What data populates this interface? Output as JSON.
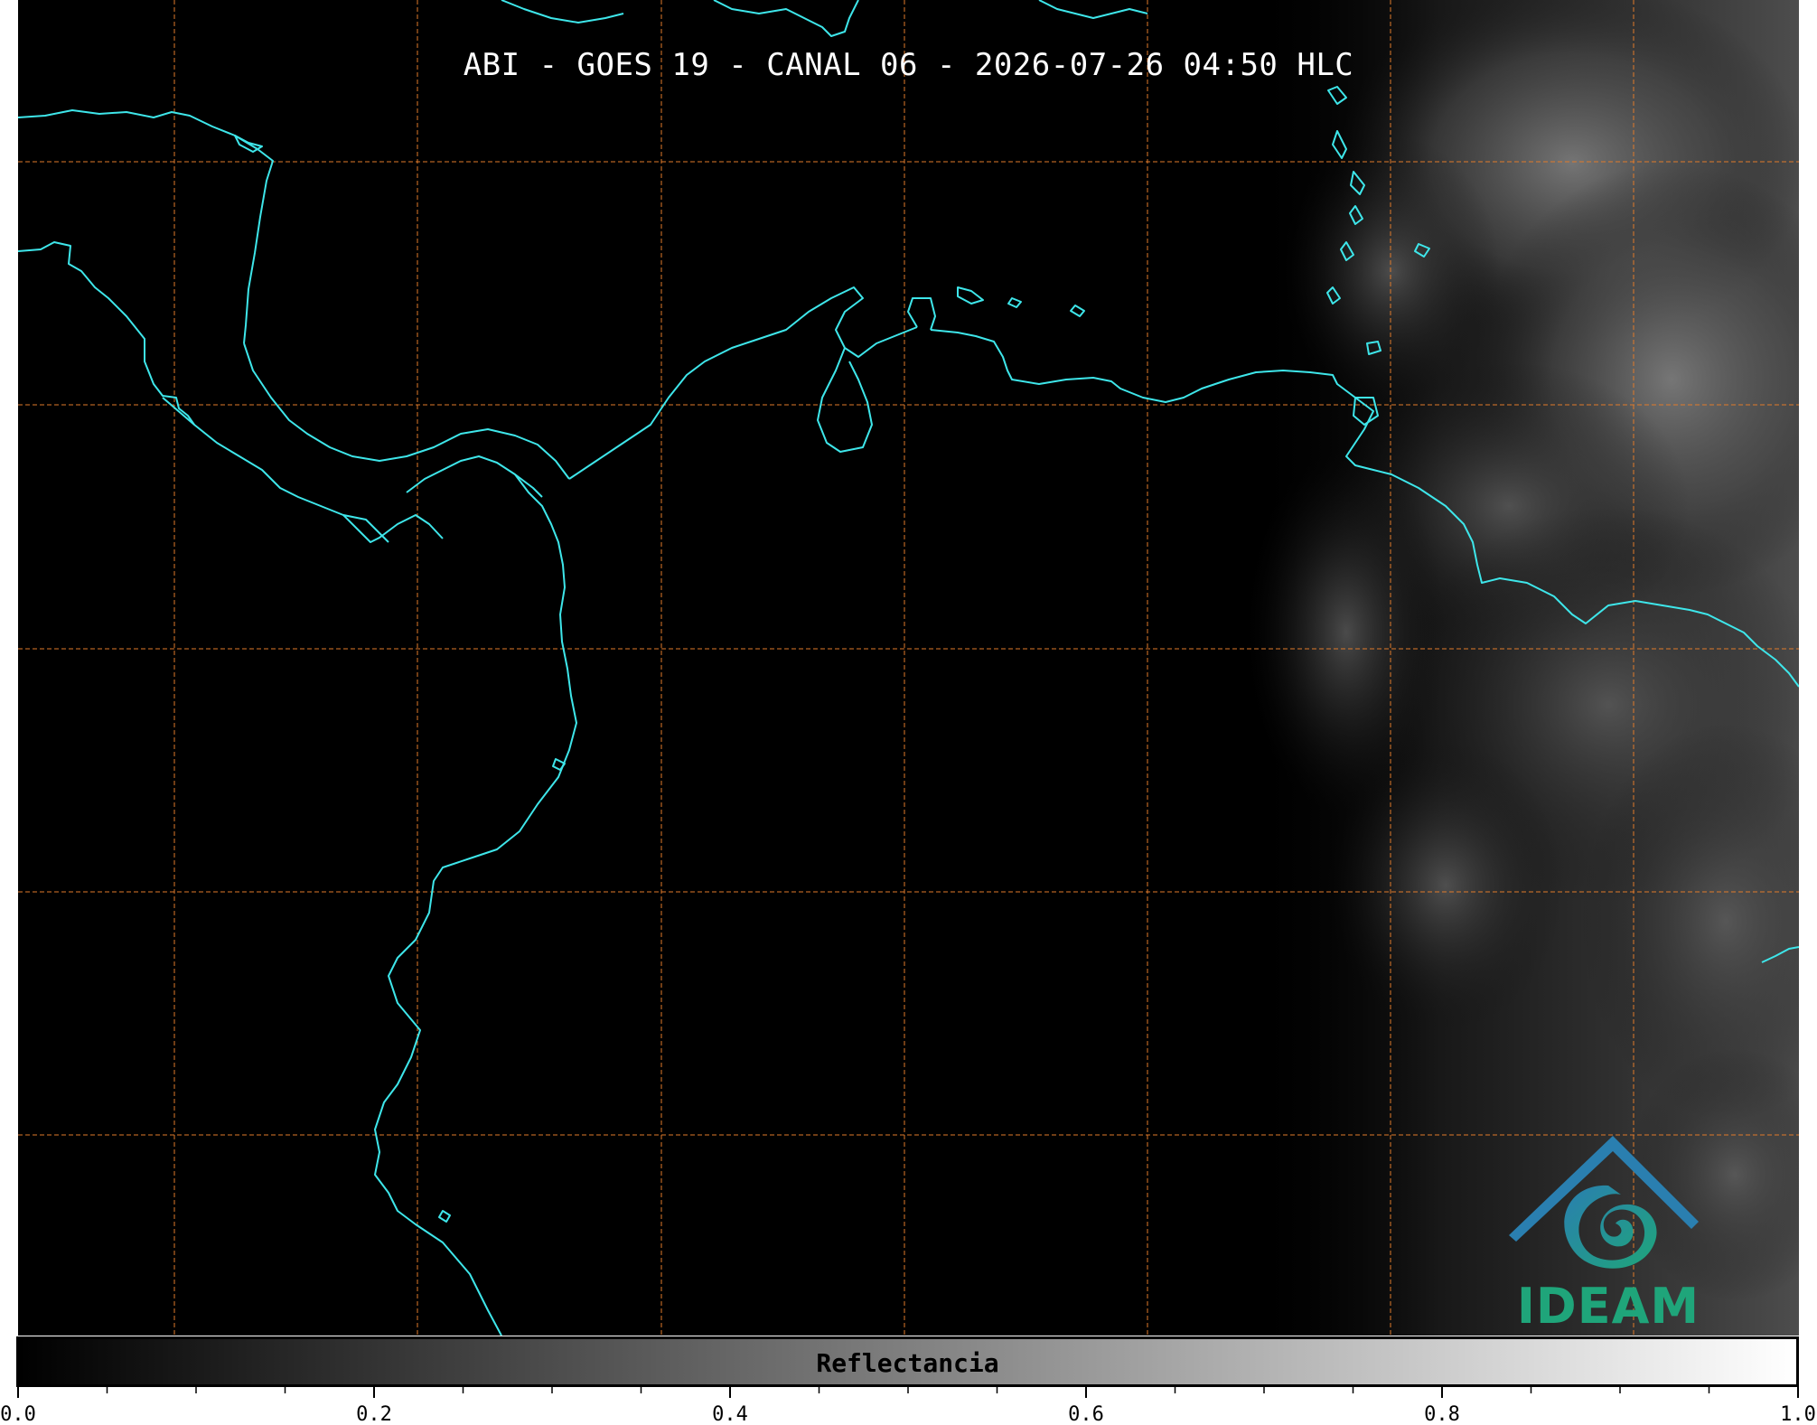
{
  "map": {
    "title": "ABI - GOES 19 - CANAL 06 - 2026-07-26 04:50 HLC",
    "gridline_color": "#e07a2a",
    "coastline_color": "#3ee6ea",
    "background_color": "#000000",
    "cloud_color": "#6a6a6a"
  },
  "logo": {
    "text": "IDEAM",
    "icon": "ideam-swirl-icon",
    "primary_color": "#1fa57a",
    "secondary_color": "#2a7fb0"
  },
  "colorbar": {
    "label": "Reflectancia",
    "min": 0.0,
    "max": 1.0,
    "gradient_start": "#000000",
    "gradient_end": "#ffffff",
    "ticks": [
      "0.0",
      "0.2",
      "0.4",
      "0.6",
      "0.8",
      "1.0"
    ]
  }
}
